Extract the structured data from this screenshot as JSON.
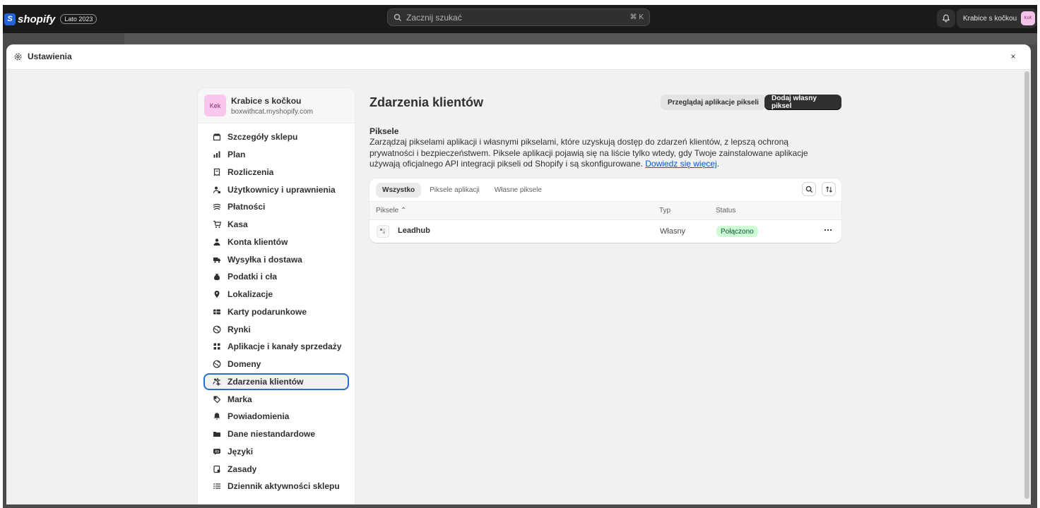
{
  "topbar": {
    "brand": "shopify",
    "brand_mark": "S",
    "season_badge": "Lato 2023",
    "search_placeholder": "Zacznij szukać",
    "search_shortcut": "⌘ K",
    "store_button": "Krabice s kočkou",
    "store_avatar_initials": "KsK"
  },
  "modal": {
    "title": "Ustawienia",
    "close_symbol": "×"
  },
  "sidebar": {
    "store_card": {
      "initials": "Kek",
      "name": "Krabice s kočkou",
      "domain": "boxwithcat.myshopify.com"
    },
    "items": [
      {
        "label": "Szczegóły sklepu",
        "icon": "store-icon"
      },
      {
        "label": "Plan",
        "icon": "plan-chart-icon"
      },
      {
        "label": "Rozliczenia",
        "icon": "receipt-icon"
      },
      {
        "label": "Użytkownicy i uprawnienia",
        "icon": "person-lock-icon"
      },
      {
        "label": "Płatności",
        "icon": "payment-icon"
      },
      {
        "label": "Kasa",
        "icon": "cart-icon"
      },
      {
        "label": "Konta klientów",
        "icon": "person-icon"
      },
      {
        "label": "Wysyłka i dostawa",
        "icon": "truck-icon"
      },
      {
        "label": "Podatki i cła",
        "icon": "tax-bag-icon"
      },
      {
        "label": "Lokalizacje",
        "icon": "location-pin-icon"
      },
      {
        "label": "Karty podarunkowe",
        "icon": "gift-card-icon"
      },
      {
        "label": "Rynki",
        "icon": "globe-icon"
      },
      {
        "label": "Aplikacje i kanały sprzedaży",
        "icon": "apps-icon"
      },
      {
        "label": "Domeny",
        "icon": "globe-icon"
      },
      {
        "label": "Zdarzenia klientów",
        "icon": "customer-events-icon",
        "active": true
      },
      {
        "label": "Marka",
        "icon": "brand-icon"
      },
      {
        "label": "Powiadomienia",
        "icon": "bell-icon"
      },
      {
        "label": "Dane niestandardowe",
        "icon": "folder-icon"
      },
      {
        "label": "Języki",
        "icon": "language-icon"
      },
      {
        "label": "Zasady",
        "icon": "policy-icon"
      },
      {
        "label": "Dziennik aktywności sklepu",
        "icon": "list-icon"
      }
    ]
  },
  "main": {
    "page_title": "Zdarzenia klientów",
    "browse_button": "Przeglądaj aplikacje pikseli",
    "add_button": "Dodaj własny piksel",
    "section_title": "Piksele",
    "section_desc": "Zarządzaj pikselami aplikacji i własnymi pikselami, które uzyskują dostęp do zdarzeń klientów, z lepszą ochroną prywatności i bezpieczeństwem. Piksele aplikacji pojawią się na liście tylko wtedy, gdy Twoje zainstalowane aplikacje używają oficjalnego API integracji pikseli od Shopify i są skonfigurowane.",
    "learn_more": "Dowiedz się więcej",
    "tabs": [
      "Wszystko",
      "Piksele aplikacji",
      "Własne piksele"
    ],
    "columns": {
      "name": "Piksele",
      "type": "Typ",
      "status": "Status"
    },
    "rows": [
      {
        "name": "Leadhub",
        "type": "Własny",
        "status": "Połączono"
      }
    ],
    "colors": {
      "accent": "#2c6ecb",
      "link": "#005bd3",
      "success_bg": "#cdfed4"
    }
  }
}
